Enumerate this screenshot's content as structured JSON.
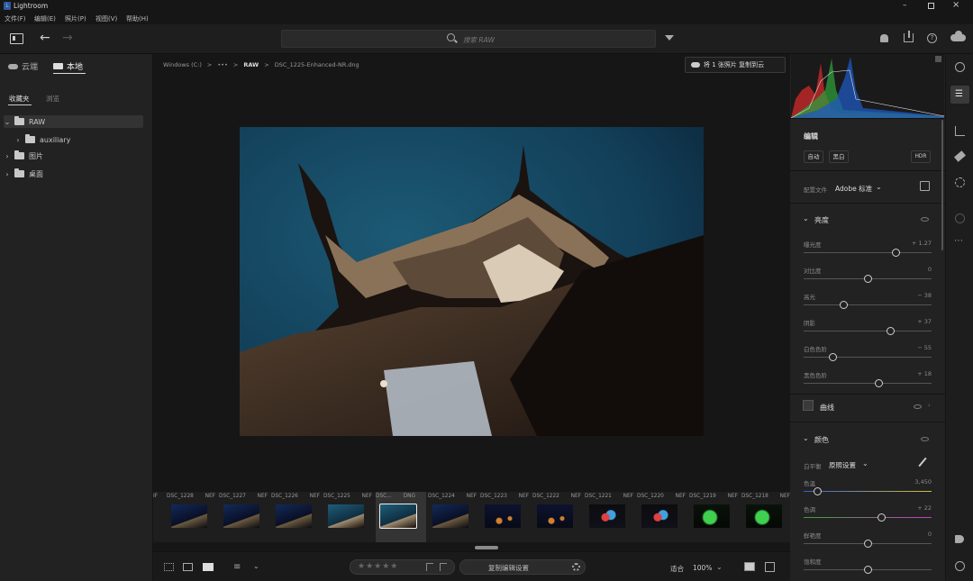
{
  "app": {
    "title": "Lightroom"
  },
  "menu": [
    "文件(F)",
    "编辑(E)",
    "照片(P)",
    "视图(V)",
    "帮助(H)"
  ],
  "search": {
    "placeholder": "搜索 RAW"
  },
  "left": {
    "tab_cloud": "云端",
    "tab_local": "本地",
    "subtab_favorites": "收藏夹",
    "subtab_browse": "浏览",
    "tree": [
      {
        "label": "RAW",
        "level": 0,
        "expanded": true,
        "selected": true
      },
      {
        "label": "auxiliary",
        "level": 1,
        "expanded": false,
        "selected": false
      },
      {
        "label": "图片",
        "level": 0,
        "expanded": false,
        "selected": false
      },
      {
        "label": "桌面",
        "level": 0,
        "expanded": false,
        "selected": false
      }
    ]
  },
  "breadcrumb": {
    "drive": "Windows (C:)",
    "sep": ">",
    "ellipsis": "•••",
    "folder": "RAW",
    "file": "DSC_1225-Enhanced-NR.dng"
  },
  "copy_to_cloud": {
    "label": "将 1 张照片 复制到云"
  },
  "filmstrip": [
    {
      "name": "DSC_1228",
      "ext": "NEF",
      "tone": "night-blue"
    },
    {
      "name": "DSC_1227",
      "ext": "NEF",
      "tone": "night-blue"
    },
    {
      "name": "DSC_1226",
      "ext": "NEF",
      "tone": "night-blue"
    },
    {
      "name": "DSC_1225",
      "ext": "NEF",
      "tone": "teal"
    },
    {
      "name": "DSC...",
      "ext": "DNG",
      "tone": "teal",
      "selected": true
    },
    {
      "name": "DSC_1224",
      "ext": "NEF",
      "tone": "night-blue"
    },
    {
      "name": "DSC_1223",
      "ext": "NEF",
      "tone": "dark-lights"
    },
    {
      "name": "DSC_1222",
      "ext": "NEF",
      "tone": "dark-lights"
    },
    {
      "name": "DSC_1221",
      "ext": "NEF",
      "tone": "colorful"
    },
    {
      "name": "DSC_1220",
      "ext": "NEF",
      "tone": "colorful"
    },
    {
      "name": "DSC_1219",
      "ext": "NEF",
      "tone": "green"
    },
    {
      "name": "DSC_1218",
      "ext": "NEF",
      "tone": "green"
    }
  ],
  "bottom": {
    "copy_settings": "复制编辑设置",
    "fit": "适合",
    "zoom": "100%"
  },
  "edit": {
    "section_title": "编辑",
    "btn_auto": "自动",
    "btn_bw": "黑白",
    "btn_hdr": "HDR",
    "profile_label": "配置文件",
    "profile_value": "Adobe 标准",
    "light_title": "亮度",
    "light_sliders": [
      {
        "label": "曝光度",
        "value": "+ 1.27",
        "pos": 0.72
      },
      {
        "label": "对比度",
        "value": "0",
        "pos": 0.5
      },
      {
        "label": "高光",
        "value": "− 38",
        "pos": 0.31
      },
      {
        "label": "阴影",
        "value": "+ 37",
        "pos": 0.68
      },
      {
        "label": "白色色阶",
        "value": "− 55",
        "pos": 0.23
      },
      {
        "label": "黑色色阶",
        "value": "+ 18",
        "pos": 0.59
      }
    ],
    "curve_title": "曲线",
    "color_title": "颜色",
    "wb_label": "白平衡",
    "wb_value": "原照设置",
    "color_sliders": [
      {
        "label": "色温",
        "value": "3,450",
        "pos": 0.11
      },
      {
        "label": "色调",
        "value": "+ 22",
        "pos": 0.61
      },
      {
        "label": "鲜艳度",
        "value": "0",
        "pos": 0.5
      },
      {
        "label": "饱和度",
        "value": "",
        "pos": 0.5
      }
    ]
  },
  "colors": {
    "accent": "#e0e0e0",
    "bg": "#1b1b1b",
    "panel": "#222222"
  }
}
